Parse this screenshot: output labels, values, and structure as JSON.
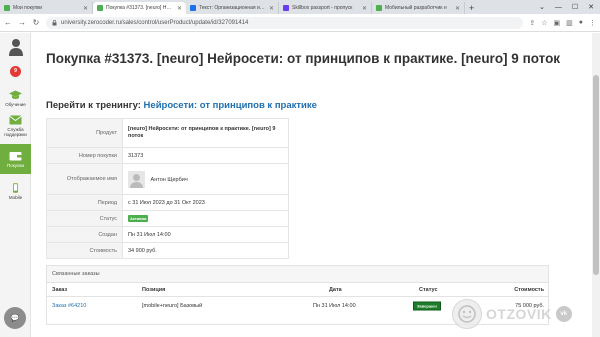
{
  "browser": {
    "tabs": [
      {
        "title": "Мои покупки",
        "color": "#4caf50",
        "active": false
      },
      {
        "title": "Покупка #31373. [neuro] Нейро",
        "color": "#4caf50",
        "active": true
      },
      {
        "title": "Текст: Организационная инф",
        "color": "#1a73e8",
        "active": false
      },
      {
        "title": "Skillbox passport - пропуск",
        "color": "#6a3df0",
        "active": false
      },
      {
        "title": "Мобильный разработчик н",
        "color": "#4caf50",
        "active": false
      }
    ],
    "new_tab": "+",
    "window_controls": [
      "⌄",
      "—",
      "☐",
      "✕"
    ],
    "url": "university.zerocoder.ru/sales/control/userProduct/update/id/327091414",
    "nav": {
      "back": "←",
      "forward": "→",
      "reload": "↻"
    }
  },
  "sidebar": {
    "items": [
      {
        "label": "",
        "icon": "user-icon"
      },
      {
        "label": "9",
        "icon": "notification-badge"
      },
      {
        "label": "Обучение",
        "icon": "graduation-cap-icon"
      },
      {
        "label": "Служба поддержки",
        "icon": "envelope-icon"
      },
      {
        "label": "Покупки",
        "icon": "wallet-icon",
        "active": true
      },
      {
        "label": "Mobile",
        "icon": "mobile-icon"
      }
    ],
    "chat_icon": "💬"
  },
  "page": {
    "title": "Покупка #31373. [neuro] Нейросети: от принципов к практике. [neuro] 9 поток",
    "go_training_prefix": "Перейти к тренингу:",
    "go_training_link": "Нейросети: от принципов к практике"
  },
  "info": {
    "product_label": "Продукт",
    "product_value": "[neuro] Нейросети: от принципов к практике. [neuro] 9 поток",
    "number_label": "Номер покупки",
    "number_value": "31373",
    "display_name_label": "Отображаемое имя",
    "display_name_value": "Антон Щербич",
    "period_label": "Период",
    "period_value": "с 31 Июл 2023 до 31 Окт 2023",
    "status_label": "Статус",
    "status_value": "Активна",
    "created_label": "Создан",
    "created_value": "Пн 31 Июл 14:00",
    "cost_label": "Стоимость",
    "cost_value": "34 900 руб."
  },
  "related": {
    "title": "Связанные заказы",
    "columns": {
      "order": "Заказ",
      "position": "Позиция",
      "date": "Дата",
      "status": "Статус",
      "cost": "Стоимость"
    },
    "rows": [
      {
        "order": "Заказ #64210",
        "position": "[mobile+neuro] Базовый",
        "date": "Пн 31 Июл 14:00",
        "status": "Завершен",
        "cost": "75 000 руб."
      }
    ]
  },
  "watermark": {
    "text": "OTZOVIK",
    "vk": "vk"
  },
  "colors": {
    "accent_green": "#6fae3f",
    "link_blue": "#1f6fb0",
    "badge_green": "#4cae4c",
    "badge_dark_green": "#1e7d2b"
  }
}
